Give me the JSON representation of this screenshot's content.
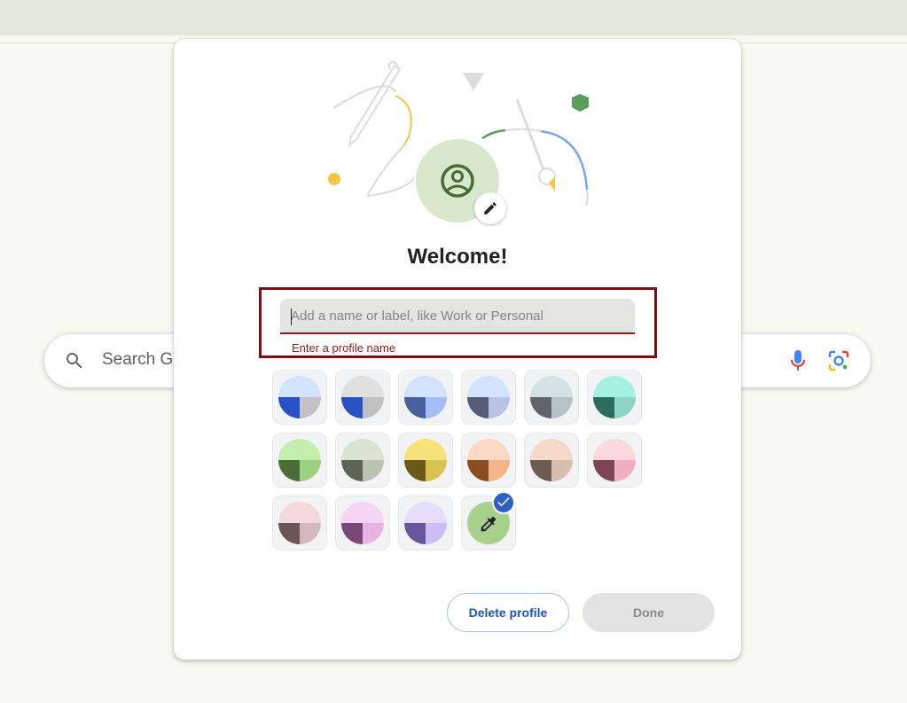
{
  "search": {
    "placeholder": "Search G"
  },
  "dialog": {
    "title": "Welcome!",
    "name_input": {
      "placeholder": "Add a name or label, like Work or Personal",
      "value": ""
    },
    "error": "Enter a profile name",
    "buttons": {
      "delete": "Delete profile",
      "done": "Done"
    }
  },
  "themes": [
    {
      "name": "blue",
      "top": "#d3e3fd",
      "left": "#2751c5",
      "right": "#c1c1c7"
    },
    {
      "name": "grey-blue",
      "top": "#e0e0e0",
      "left": "#2751c5",
      "right": "#c1c1c1"
    },
    {
      "name": "periwinkle",
      "top": "#d3e3fd",
      "left": "#4a5f9d",
      "right": "#a6bcf4"
    },
    {
      "name": "slate",
      "top": "#d3e3fd",
      "left": "#565e77",
      "right": "#b8c3e3"
    },
    {
      "name": "cool-grey",
      "top": "#d4e3e4",
      "left": "#5e6467",
      "right": "#b6c3c6"
    },
    {
      "name": "aqua",
      "top": "#a4f0e2",
      "left": "#2d6b5f",
      "right": "#8fd3c6"
    },
    {
      "name": "green",
      "top": "#c5efae",
      "left": "#4c6d3a",
      "right": "#9ed17f"
    },
    {
      "name": "sage",
      "top": "#d9e4d1",
      "left": "#5d6358",
      "right": "#b8c3b0"
    },
    {
      "name": "yellow",
      "top": "#f7e17a",
      "left": "#6a5a17",
      "right": "#d9c152"
    },
    {
      "name": "peach",
      "top": "#fbd9c4",
      "left": "#8a4c22",
      "right": "#f5b486"
    },
    {
      "name": "taupe",
      "top": "#f6d9c8",
      "left": "#6b5b50",
      "right": "#d9bfb0"
    },
    {
      "name": "rose",
      "top": "#fbd9dc",
      "left": "#7e4654",
      "right": "#f0b0bd"
    },
    {
      "name": "blush",
      "top": "#f5d9da",
      "left": "#6b5656",
      "right": "#d5b8b9"
    },
    {
      "name": "orchid",
      "top": "#f6d4f3",
      "left": "#7a4877",
      "right": "#e7b3e3"
    },
    {
      "name": "lavender",
      "top": "#e6dcfb",
      "left": "#6a56a0",
      "right": "#cdbdf5"
    }
  ],
  "selected_theme": "custom",
  "colors": {
    "accent": "#2e5ec9",
    "error": "#8c1d18",
    "avatar_bg": "#d7e8cc",
    "avatar_icon": "#4a6b33",
    "custom_color": "#a8d08d"
  },
  "icons": [
    "search-icon",
    "mic-icon",
    "lens-icon",
    "person-icon",
    "pencil-icon",
    "eyedropper-icon",
    "check-icon"
  ]
}
